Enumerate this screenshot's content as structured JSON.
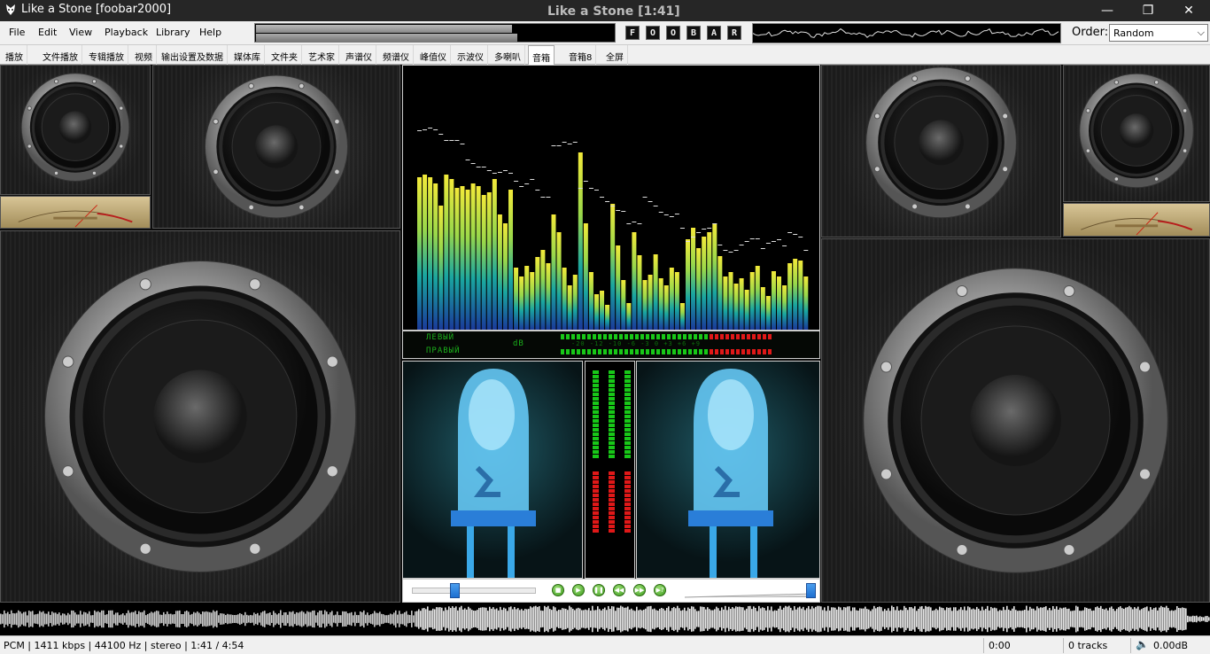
{
  "window": {
    "title": "Like a Stone  [foobar2000]",
    "center_title": "Like a Stone [1:41]",
    "minimize": "—",
    "maximize": "❐",
    "close": "✕"
  },
  "menu": [
    "File",
    "Edit",
    "View",
    "Playback",
    "Library",
    "Help"
  ],
  "seek": {
    "position_fraction": 0.716
  },
  "logo_buttons": [
    "F",
    "O",
    "O",
    "B",
    "A",
    "R"
  ],
  "order": {
    "label": "Order:",
    "value": "Random"
  },
  "tabs": [
    "播放",
    "文件播放",
    "专辑播放",
    "视频",
    "输出设置及数据",
    "媒体库",
    "文件夹",
    "艺术家",
    "声谱仪",
    "频谱仪",
    "峰值仪",
    "示波仪",
    "多喇叭",
    "音箱",
    "音箱8",
    "全屏"
  ],
  "active_tab": "音箱",
  "vu": {
    "left_label": "ЛЕВЫЙ",
    "right_label": "ПРАВЫЙ",
    "db_label": "dB",
    "scale": "-20  -12  -10  -6  -3  0  +3  +6  +9"
  },
  "volume": {
    "level_fraction": 0.97
  },
  "balance": {
    "position_fraction": 0.34
  },
  "playback_buttons": [
    {
      "name": "stop",
      "glyph": "■"
    },
    {
      "name": "play",
      "glyph": "▶"
    },
    {
      "name": "pause",
      "glyph": "❚❚"
    },
    {
      "name": "previous",
      "glyph": "◀◀"
    },
    {
      "name": "next",
      "glyph": "▶▶"
    },
    {
      "name": "random",
      "glyph": "▶?"
    }
  ],
  "status": {
    "info": "PCM | 1411 kbps | 44100 Hz | stereo | 1:41 / 4:54",
    "time": "0:00",
    "tracks": "0 tracks",
    "volume": "0.00dB"
  },
  "colors": {
    "spectrum_top": "#f0e840",
    "spectrum_bottom": "#1a3a9a",
    "vu_green": "#18c818",
    "vu_red": "#e01818",
    "led_blue": "#4ec0ff"
  }
}
